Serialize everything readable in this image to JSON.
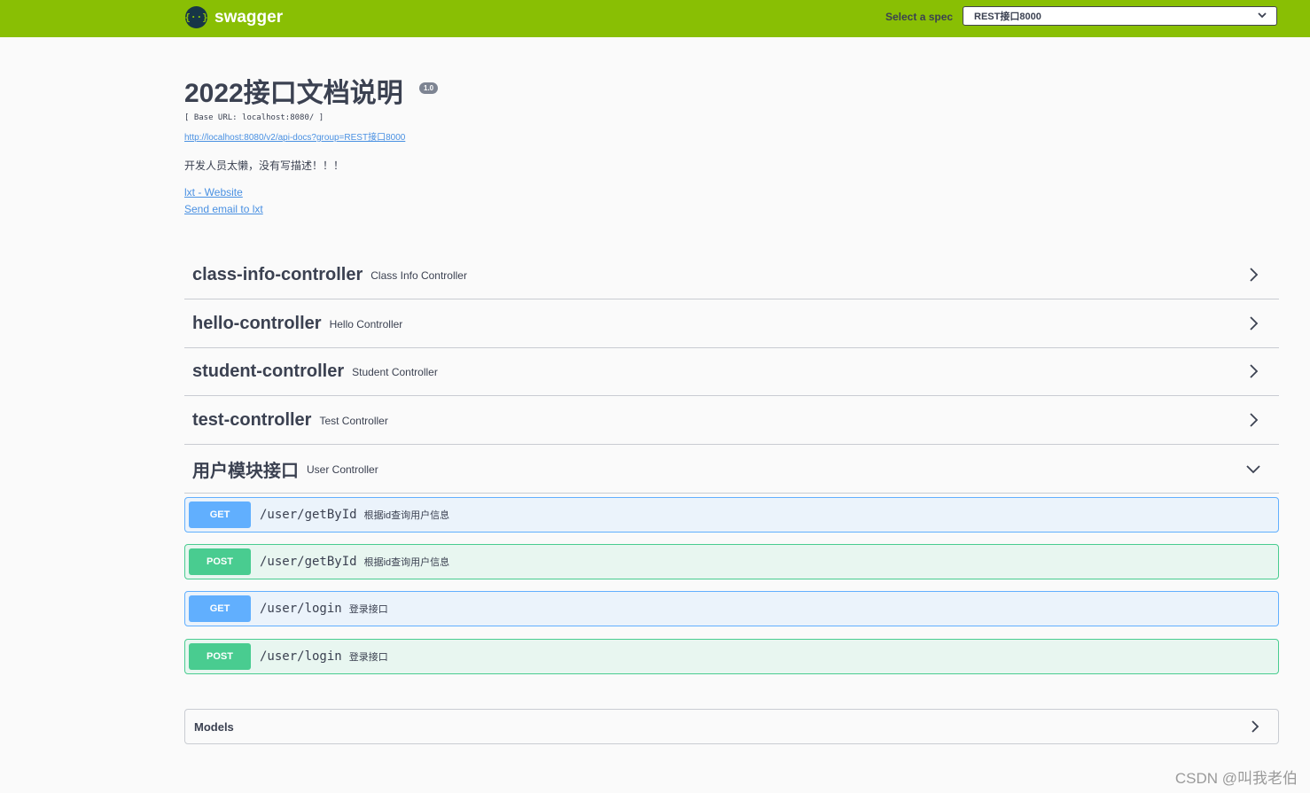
{
  "topbar": {
    "logo_glyph": "{··}",
    "brand": "swagger",
    "select_label": "Select a spec",
    "selected_spec": "REST接口8000",
    "icon": "chevron-down-icon"
  },
  "info": {
    "title": "2022接口文档说明",
    "version": "1.0",
    "base_url": "[ Base URL: localhost:8080/ ]",
    "spec_url": "http://localhost:8080/v2/api-docs?group=REST接口8000",
    "description": "开发人员太懒，没有写描述！！！",
    "website_link": "lxt - Website",
    "email_link": "Send email to lxt"
  },
  "tags": [
    {
      "name": "class-info-controller",
      "description": "Class Info Controller",
      "expanded": false
    },
    {
      "name": "hello-controller",
      "description": "Hello Controller",
      "expanded": false
    },
    {
      "name": "student-controller",
      "description": "Student Controller",
      "expanded": false
    },
    {
      "name": "test-controller",
      "description": "Test Controller",
      "expanded": false
    },
    {
      "name": "用户模块接口",
      "description": "User Controller",
      "expanded": true
    }
  ],
  "operations": [
    {
      "method": "GET",
      "path": "/user/getById",
      "summary": "根据id查询用户信息"
    },
    {
      "method": "POST",
      "path": "/user/getById",
      "summary": "根据id查询用户信息"
    },
    {
      "method": "GET",
      "path": "/user/login",
      "summary": "登录接口"
    },
    {
      "method": "POST",
      "path": "/user/login",
      "summary": "登录接口"
    }
  ],
  "models": {
    "label": "Models"
  },
  "watermark": "CSDN @叫我老伯",
  "colors": {
    "topbar": "#89bf04",
    "get": "#61affe",
    "post": "#49cc90",
    "link": "#4990e2",
    "text": "#3b4151"
  }
}
